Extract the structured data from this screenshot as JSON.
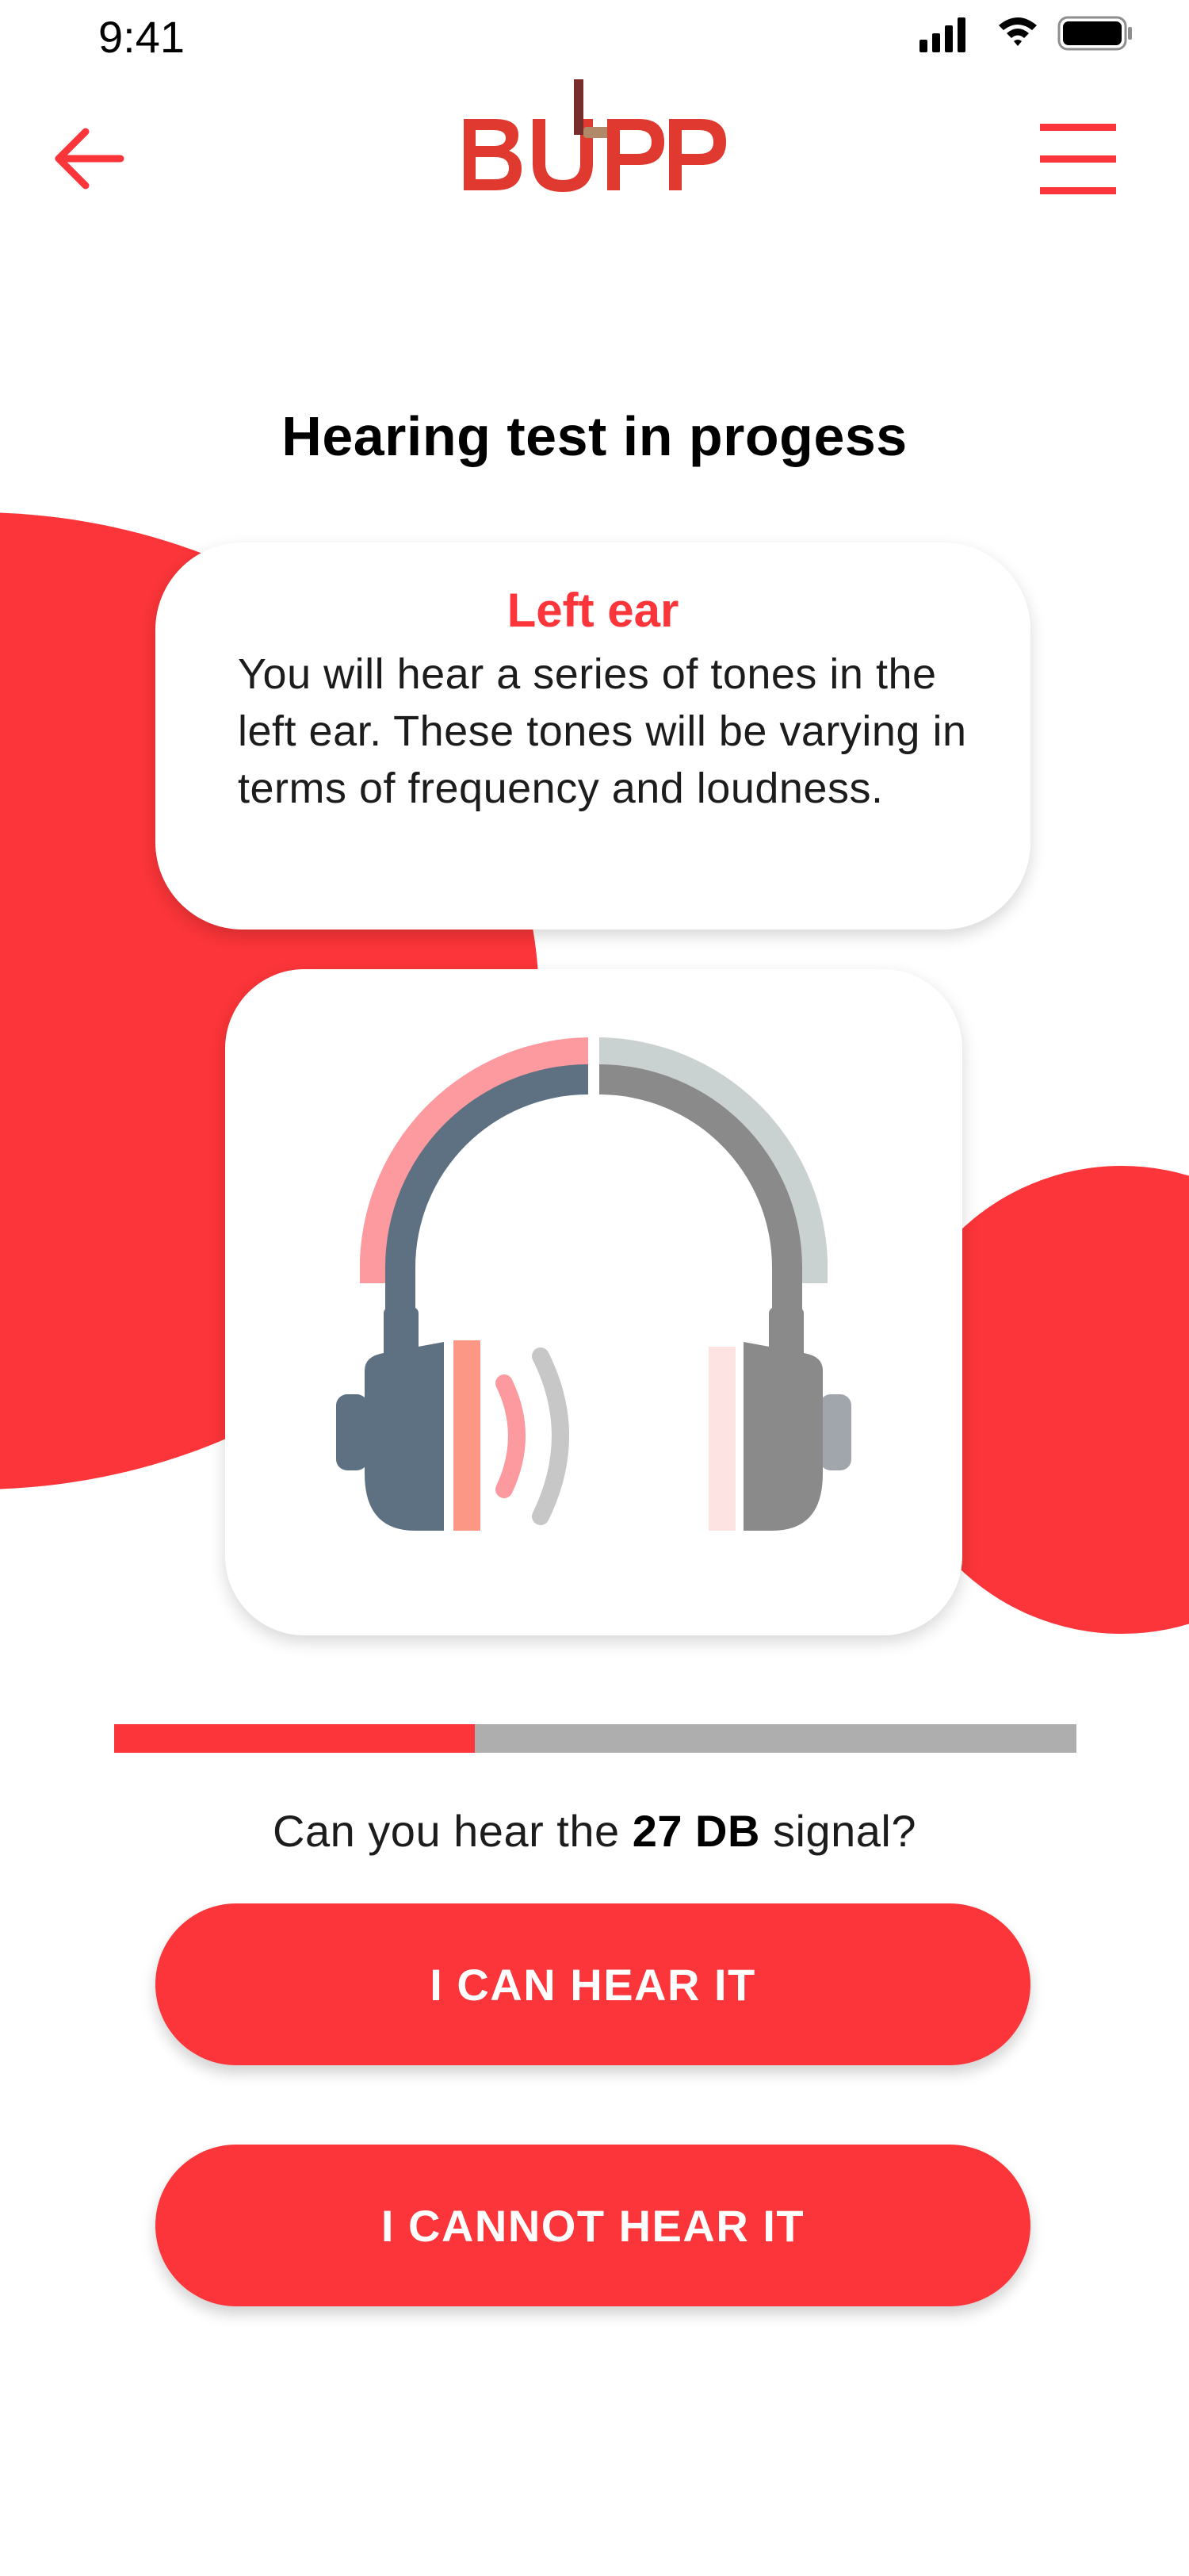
{
  "status_bar": {
    "time": "9:41",
    "icons": [
      "signal-icon",
      "wifi-icon",
      "battery-icon"
    ]
  },
  "header": {
    "back_icon": "arrow-left-icon",
    "logo_text": "BUPP",
    "menu_icon": "hamburger-menu-icon"
  },
  "page": {
    "title": "Hearing test in progess"
  },
  "info_card": {
    "title": "Left ear",
    "body": "You will hear a series of tones in the left ear. These tones will be varying in terms of frequency and loudness."
  },
  "illustration": {
    "icon": "headphones-icon",
    "active_side": "left"
  },
  "progress": {
    "fraction": 0.375
  },
  "question": {
    "prefix": "Can you hear the ",
    "value": "27 DB",
    "suffix": " signal?"
  },
  "actions": {
    "yes_label": "I CAN HEAR IT",
    "no_label": "I CANNOT HEAR IT"
  },
  "colors": {
    "accent": "#fb3539",
    "track": "#aeaeae",
    "headphone_dark": "#5e7182",
    "headphone_gray": "#8a8a8a",
    "wave_pink": "#fc9a9f"
  }
}
